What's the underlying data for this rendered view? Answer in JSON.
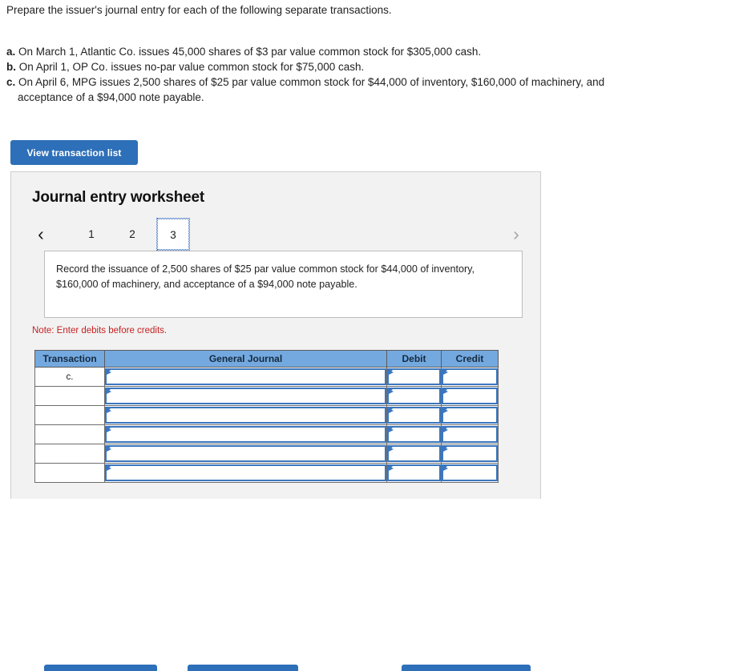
{
  "prompt": {
    "text": "Prepare the issuer's journal entry for each of the following separate transactions."
  },
  "transactions": [
    {
      "label": "a.",
      "text": "On March 1, Atlantic Co. issues 45,000 shares of $3 par value common stock for $305,000 cash."
    },
    {
      "label": "b.",
      "text": "On April 1, OP Co. issues no-par value common stock for $75,000 cash."
    },
    {
      "label": "c.",
      "text": "On April 6, MPG issues 2,500 shares of $25 par value common stock for $44,000 of inventory, $160,000 of machinery, and"
    },
    {
      "label": "",
      "text": "acceptance of a $94,000 note payable."
    }
  ],
  "view_transaction_button": {
    "label": "View transaction list"
  },
  "worksheet": {
    "title": "Journal entry worksheet",
    "pager": {
      "prev_icon": "‹",
      "next_icon": "›",
      "tabs": [
        "1",
        "2",
        "3"
      ],
      "selected": "3"
    },
    "description": "Record the issuance of 2,500 shares of $25 par value common stock for $44,000 of inventory, $160,000 of machinery, and acceptance of a $94,000 note payable.",
    "note": "Note: Enter debits before credits.",
    "table": {
      "columns": [
        "Transaction",
        "General Journal",
        "Debit",
        "Credit"
      ],
      "rows": [
        {
          "transaction": "c.",
          "general_journal": "",
          "debit": "",
          "credit": ""
        },
        {
          "transaction": "",
          "general_journal": "",
          "debit": "",
          "credit": ""
        },
        {
          "transaction": "",
          "general_journal": "",
          "debit": "",
          "credit": ""
        },
        {
          "transaction": "",
          "general_journal": "",
          "debit": "",
          "credit": ""
        },
        {
          "transaction": "",
          "general_journal": "",
          "debit": "",
          "credit": ""
        },
        {
          "transaction": "",
          "general_journal": "",
          "debit": "",
          "credit": ""
        }
      ]
    },
    "actions": [
      {
        "label": ""
      },
      {
        "label": ""
      },
      {
        "label": ""
      }
    ]
  },
  "colors": {
    "primary_blue": "#2d6fb8",
    "header_blue": "#74a9e0",
    "field_border": "#3b76bf",
    "note_red": "#c42121",
    "panel_bg": "#f2f2f2"
  }
}
